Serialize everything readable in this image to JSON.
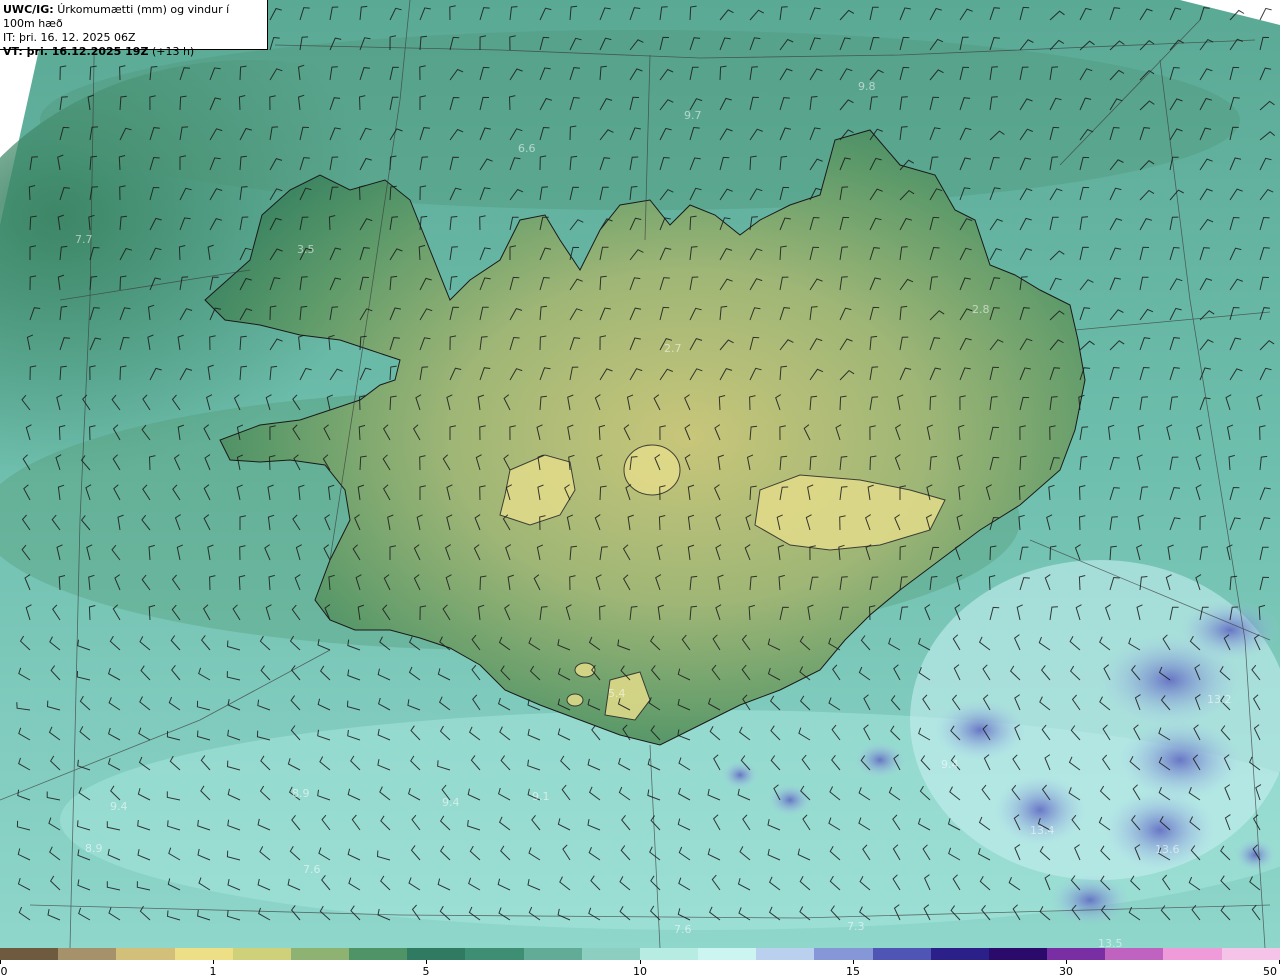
{
  "header": {
    "product": "UWC/IG:",
    "description": "Úrkomumætti (mm) og vindur í 100m hæð",
    "it_line": "IT: þri. 16. 12. 2025 06Z",
    "vt_prefix": "VT: þri. 16.12.2025 19Z",
    "vt_suffix": "(+13 h)"
  },
  "map_labels": [
    "9.8",
    "9.7",
    "6.6",
    "3.5",
    "7.7",
    "2.8",
    "2.7",
    "5.4",
    "9.4",
    "8.9",
    "8.9",
    "9.4",
    "9.1",
    "7.6",
    "7.6",
    "7.3",
    "9.4",
    "13.4",
    "13.2",
    "13.6",
    "13.5"
  ],
  "colorbar": {
    "ticks": [
      "0",
      "1",
      "5",
      "10",
      "15",
      "30",
      "50"
    ],
    "colors": [
      "#6e5a3e",
      "#a5916a",
      "#d2c07a",
      "#ecdf86",
      "#cfd17a",
      "#8db271",
      "#4f9467",
      "#2f7a60",
      "#3e8e74",
      "#62ab97",
      "#8ccfc0",
      "#b7ece3",
      "#ccf5f2",
      "#b9d0ee",
      "#8597d6",
      "#4e55b4",
      "#2b1f8a",
      "#2a0a6a",
      "#7a2ea3",
      "#c062c0",
      "#ef9bda",
      "#f4c3e7"
    ]
  }
}
